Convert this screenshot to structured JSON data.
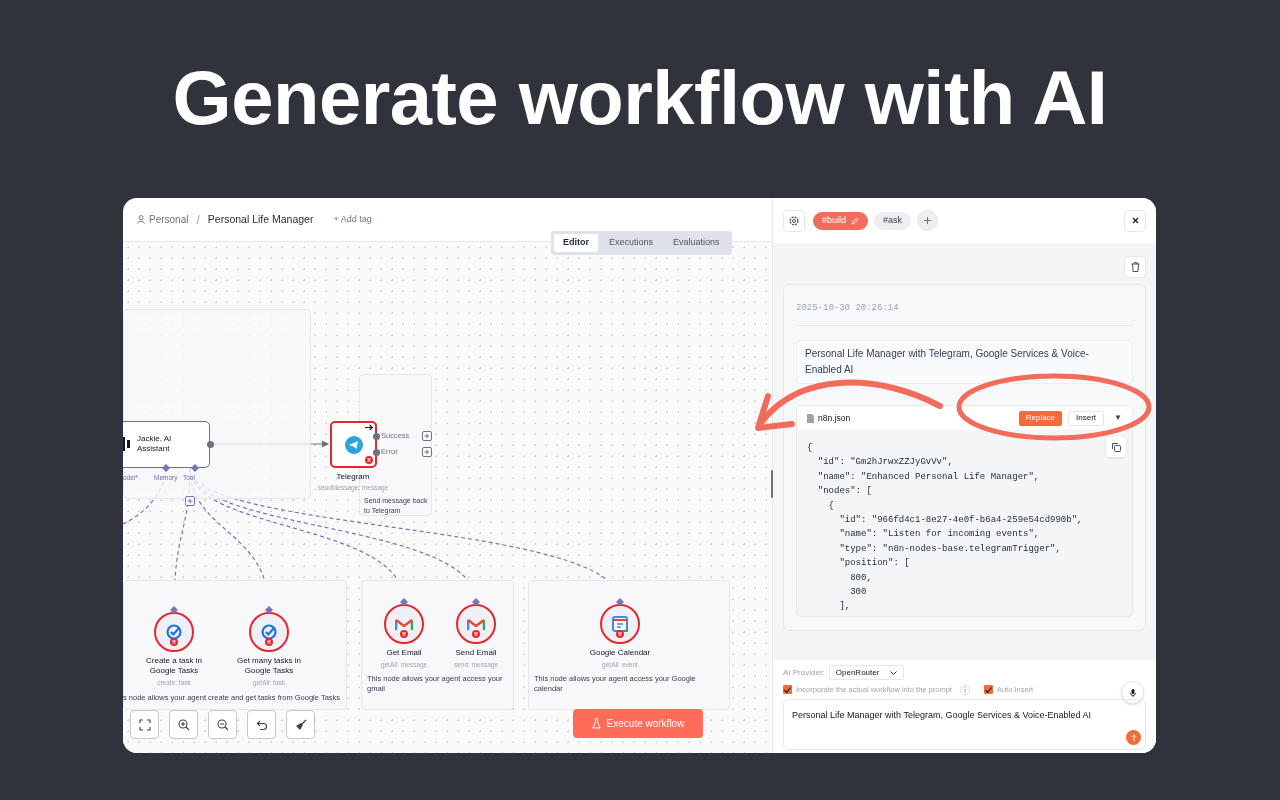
{
  "headline": "Generate workflow with AI",
  "breadcrumb": {
    "project": "Personal",
    "separator": "/",
    "workflow": "Personal Life Manager",
    "add_tag": "+ Add tag"
  },
  "view_tabs": [
    {
      "label": "Editor",
      "selected": true
    },
    {
      "label": "Executions",
      "selected": false
    },
    {
      "label": "Evaluations",
      "selected": false
    }
  ],
  "agent_node": {
    "name": "Jackie, AI Assistant",
    "inputs": [
      {
        "label": "odel",
        "mark": "*"
      },
      {
        "label": "Memory"
      },
      {
        "label": "Tool"
      }
    ]
  },
  "telegram_node": {
    "name": "Telegram",
    "subtitle": "sendMessage: message",
    "error": true,
    "outputs": [
      "Success",
      "Error"
    ]
  },
  "note": {
    "text": "Send message back to Telegram"
  },
  "groups": [
    {
      "description": "s node allows your agent create and get tasks from Google Tasks",
      "nodes": [
        {
          "kind": "tasks",
          "name": "Create a task in Google Tasks",
          "subtitle": "create: task",
          "error": true
        },
        {
          "kind": "tasks",
          "name": "Get many tasks in Google Tasks",
          "subtitle": "getAll: task",
          "error": true
        }
      ]
    },
    {
      "description": "This node allows your agent access your gmail",
      "nodes": [
        {
          "kind": "gmail",
          "name": "Get Email",
          "subtitle": "getAll: message",
          "error": true
        },
        {
          "kind": "gmail",
          "name": "Send Email",
          "subtitle": "send: message",
          "error": true
        }
      ]
    },
    {
      "description": "This node allows your agent access your Google calendar",
      "nodes": [
        {
          "kind": "calendar",
          "name": "Google Calendar",
          "subtitle": "getAll: event",
          "error": true
        }
      ]
    }
  ],
  "canvas_tools": [
    {
      "kind": "fit"
    },
    {
      "kind": "zoom_in"
    },
    {
      "kind": "zoom_out"
    },
    {
      "kind": "undo"
    },
    {
      "kind": "tidy"
    }
  ],
  "execute_button": "Execute workflow",
  "assistant": {
    "modes": [
      {
        "label": "#build",
        "selected": true
      },
      {
        "label": "#ask",
        "selected": false
      }
    ],
    "messages": [
      {
        "timestamp": "2025-10-30 20:26:14",
        "prompt": "Personal Life Manager with Telegram, Google Services & Voice-Enabled AI",
        "file": {
          "name": "n8n.json",
          "actions": [
            {
              "label": "Replace",
              "primary": true
            },
            {
              "label": "Insert",
              "primary": false
            }
          ],
          "menu": "▼",
          "code": "{\n  \"id\": \"Gm2hJrwxZZJyGvVv\",\n  \"name\": \"Enhanced Personal Life Manager\",\n  \"nodes\": [\n    {\n      \"id\": \"966fd4c1-8e27-4e0f-b6a4-259e54cd990b\",\n      \"name\": \"Listen for incoming events\",\n      \"type\": \"n8n-nodes-base.telegramTrigger\",\n      \"position\": [\n        800,\n        300\n      ],"
        }
      }
    ],
    "composer": {
      "provider_label": "AI Provider:",
      "provider": "OpenRouter",
      "options": [
        {
          "label": "Incorporate the actual workflow into the prompt",
          "checked": true,
          "info": true
        },
        {
          "label": "Auto Insert",
          "checked": true,
          "info": false
        }
      ],
      "input": "Personal Life Manager with Telegram, Google Services & Voice-Enabled AI"
    }
  }
}
